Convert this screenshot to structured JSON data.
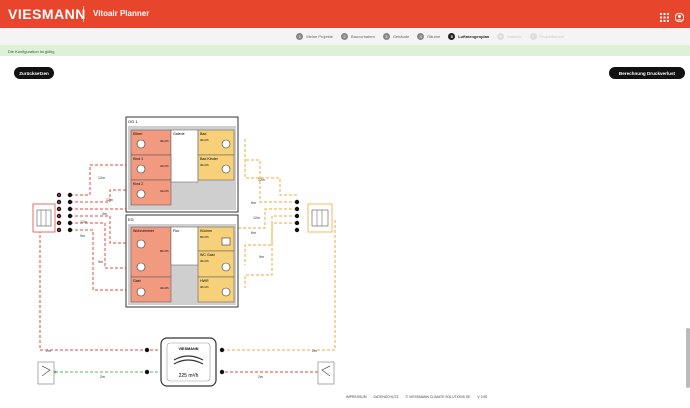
{
  "header": {
    "brand": "VIESMANN",
    "app_title": "Vitoair Planner"
  },
  "steps": [
    {
      "num": "1",
      "label": "Meine Projekte",
      "state": "done"
    },
    {
      "num": "2",
      "label": "Bauvorhaben",
      "state": "done"
    },
    {
      "num": "3",
      "label": "Gebäude",
      "state": "done"
    },
    {
      "num": "4",
      "label": "Räume",
      "state": "done"
    },
    {
      "num": "5",
      "label": "Luftmengenplan",
      "state": "active"
    },
    {
      "num": "6",
      "label": "Material",
      "state": "disabled"
    },
    {
      "num": "7",
      "label": "Projektbericht",
      "state": "disabled"
    }
  ],
  "status": {
    "message": "Die Konfiguration ist gültig"
  },
  "actions": {
    "reset_label": "Zurücksetzen",
    "pressure_loss_label": "Berechnung Druckverlust"
  },
  "floors": {
    "og": {
      "name": "OG 1",
      "rooms": [
        {
          "name": "Eltern",
          "value": "40m³/h",
          "type": "supply"
        },
        {
          "name": "Galerie",
          "value": "",
          "type": "transfer"
        },
        {
          "name": "Bad",
          "value": "40m³/h",
          "type": "exhaust"
        },
        {
          "name": "Kind 1",
          "value": "34m³/h",
          "type": "supply"
        },
        {
          "name": "Bad Kinder",
          "value": "40m³/h",
          "type": "exhaust"
        },
        {
          "name": "Kind 2",
          "value": "34m³/h",
          "type": "supply"
        }
      ]
    },
    "eg": {
      "name": "EG",
      "rooms": [
        {
          "name": "Wohnzimmer",
          "value": "82m³/h",
          "type": "supply"
        },
        {
          "name": "Flur",
          "value": "",
          "type": "transfer"
        },
        {
          "name": "Küchen",
          "value": "60m³/h",
          "type": "exhaust"
        },
        {
          "name": "WC Gast",
          "value": "40m³/h",
          "type": "exhaust"
        },
        {
          "name": "HWR",
          "value": "40m³/h",
          "type": "exhaust"
        },
        {
          "name": "Gast",
          "value": "34m³/h",
          "type": "supply"
        }
      ]
    }
  },
  "pipes": {
    "left": [
      "12m",
      "12m",
      "4m",
      "12m",
      "9m",
      "9m"
    ],
    "right": [
      "12m",
      "6m",
      "12m",
      "6m",
      "9m"
    ],
    "device_left": "2m",
    "device_right": "2m",
    "bottom_left": "2m",
    "bottom_right": "2m"
  },
  "device": {
    "brand": "VIESMANN",
    "flow": "225 m³/h"
  },
  "footer": {
    "impressum": "IMPRESSUM",
    "privacy": "DATENSCHUTZ",
    "copyright": "© VIESSMANN CLIMATE SOLUTIONS SE",
    "version": "V 3.95"
  },
  "colors": {
    "brand": "#e8462c",
    "supply": "#f29a7f",
    "exhaust": "#f7d07a",
    "supply_line": "#e84a3a",
    "exhaust_line": "#f2a93b",
    "outdoor_line": "#5cb85c",
    "outgoing_line": "#e8462c"
  }
}
